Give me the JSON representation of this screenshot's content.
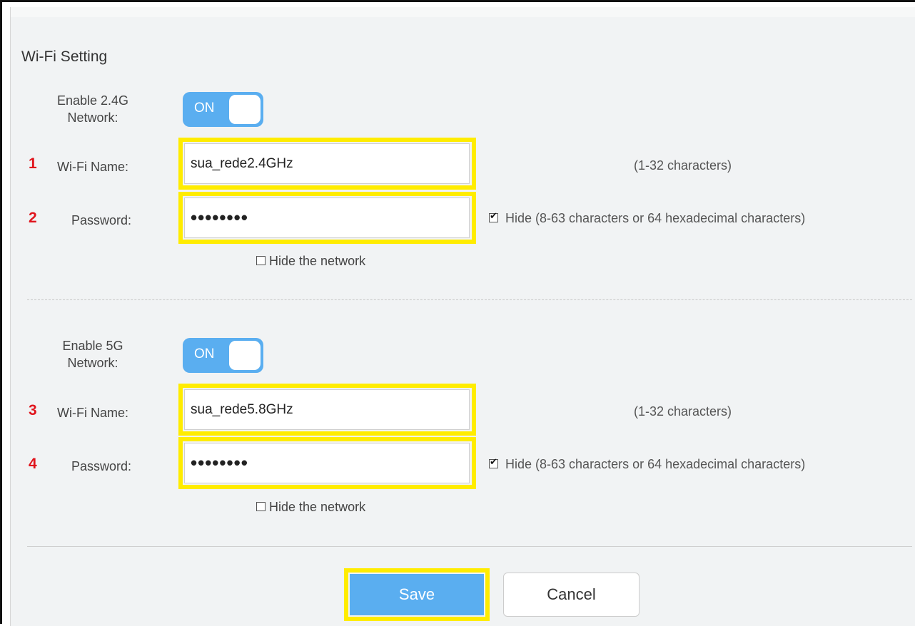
{
  "title": "Wi-Fi Setting",
  "band24": {
    "enable_label_line1": "Enable 2.4G",
    "enable_label_line2": "Network:",
    "toggle_text": "ON",
    "name_label": "Wi-Fi Name:",
    "name_value": "sua_rede2.4GHz",
    "name_hint": "(1-32 characters)",
    "password_label": "Password:",
    "password_value": "••••••••",
    "hide_label": "Hide (8-63 characters or 64 hexadecimal characters)",
    "hide_checked": true,
    "hide_network_label": "Hide the network",
    "hide_network_checked": false,
    "step_name": "1",
    "step_password": "2"
  },
  "band5": {
    "enable_label_line1": "Enable 5G",
    "enable_label_line2": "Network:",
    "toggle_text": "ON",
    "name_label": "Wi-Fi Name:",
    "name_value": "sua_rede5.8GHz",
    "name_hint": "(1-32 characters)",
    "password_label": "Password:",
    "password_value": "••••••••",
    "hide_label": "Hide (8-63 characters or 64 hexadecimal characters)",
    "hide_checked": true,
    "hide_network_label": "Hide the network",
    "hide_network_checked": false,
    "step_name": "3",
    "step_password": "4"
  },
  "buttons": {
    "save": "Save",
    "cancel": "Cancel"
  },
  "colors": {
    "accent": "#5aaef0",
    "highlight": "#ffec00",
    "step_number": "#e0141c"
  }
}
